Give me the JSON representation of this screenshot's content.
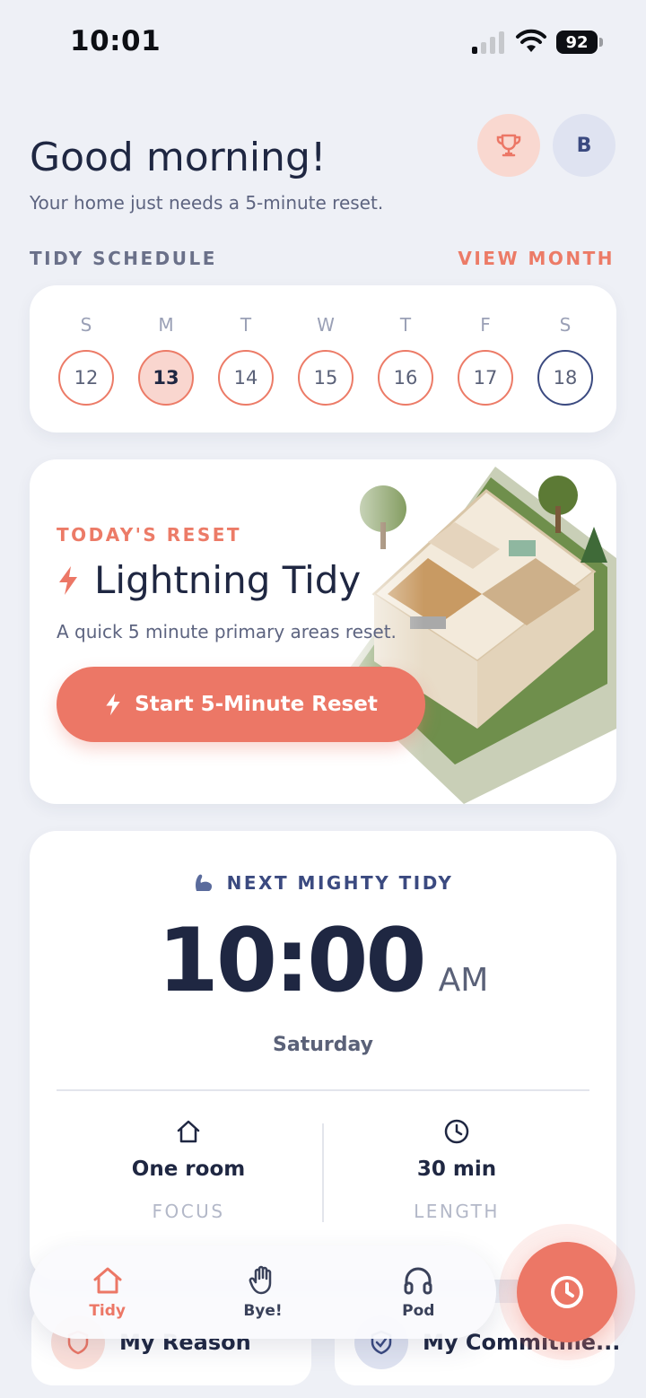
{
  "status_bar": {
    "time": "10:01",
    "battery": "92"
  },
  "header": {
    "greeting": "Good morning!",
    "subtitle": "Your home just needs a 5-minute reset.",
    "avatar_initial": "B"
  },
  "schedule": {
    "label": "TIDY SCHEDULE",
    "view_month": "VIEW MONTH",
    "days": [
      {
        "letter": "S",
        "num": "12"
      },
      {
        "letter": "M",
        "num": "13"
      },
      {
        "letter": "T",
        "num": "14"
      },
      {
        "letter": "W",
        "num": "15"
      },
      {
        "letter": "T",
        "num": "16"
      },
      {
        "letter": "F",
        "num": "17"
      },
      {
        "letter": "S",
        "num": "18"
      }
    ]
  },
  "today_reset": {
    "label": "TODAY'S RESET",
    "title": "Lightning Tidy",
    "description": "A quick 5 minute primary areas reset.",
    "button": "Start 5-Minute Reset"
  },
  "next_tidy": {
    "label": "NEXT MIGHTY TIDY",
    "time": "10:00",
    "ampm": "AM",
    "day": "Saturday",
    "focus_value": "One room",
    "focus_label": "FOCUS",
    "length_value": "30 min",
    "length_label": "LENGTH"
  },
  "bottom_cards": {
    "reason": "My Reason",
    "commitment": "My Commitme..."
  },
  "tabs": [
    {
      "label": "Tidy",
      "icon": "home-icon"
    },
    {
      "label": "Bye!",
      "icon": "waving-hand-icon"
    },
    {
      "label": "Pod",
      "icon": "headphones-icon"
    }
  ],
  "colors": {
    "accent": "#ec7766",
    "navy": "#3b4a80",
    "text": "#1f2742",
    "background": "#eef0f6"
  }
}
